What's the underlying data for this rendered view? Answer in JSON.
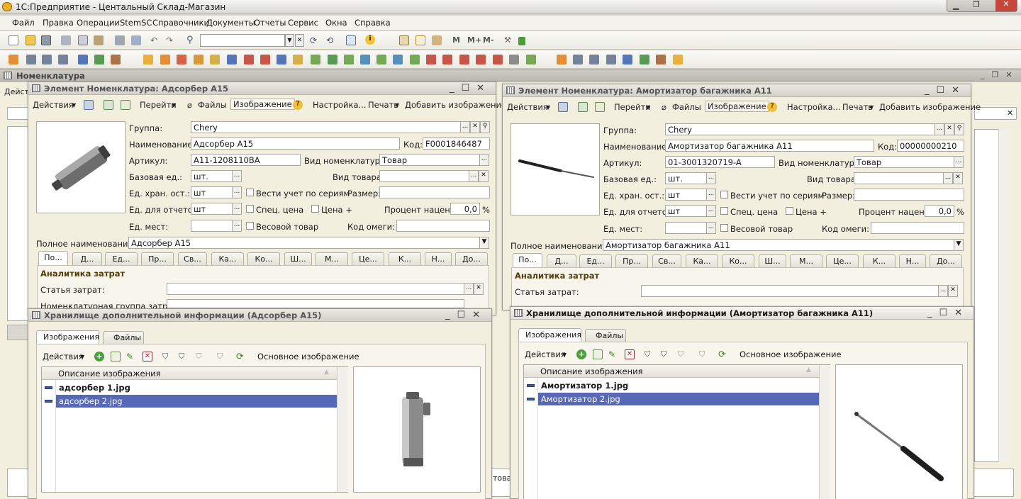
{
  "app_title": "1С:Предприятие - Центальный Склад-Магазин",
  "menu": [
    "Файл",
    "Правка",
    "Операции",
    "StemSC",
    "Справочники",
    "Документы",
    "Отчеты",
    "Сервис",
    "Окна",
    "Справка"
  ],
  "toolbar_memory": [
    "M",
    "M+",
    "M-"
  ],
  "main_window": {
    "title": "Номенклатура",
    "actions": "Дейст"
  },
  "form_labels": {
    "group": "Группа:",
    "name": "Наименование:",
    "code": "Код:",
    "article": "Артикул:",
    "nom_kind": "Вид номенклатуры:",
    "base_unit": "Базовая ед.:",
    "goods_kind": "Вид товара:",
    "storage_unit": "Ед. хран. ост.:",
    "series": "Вести учет по сериям",
    "size": "Размер:",
    "report_unit": "Ед. для отчетов:",
    "spec_price": "Спец. цена",
    "price_plus": "Цена +",
    "markup": "Процент наценки:",
    "places": "Ед. мест:",
    "weight": "Весовой товар",
    "omega": "Код омеги:",
    "full_name": "Полное наименование:",
    "analytics": "Аналитика затрат",
    "cost_item": "Статья затрат:",
    "nom_group_cost": "Номенклатурная группа затрат:",
    "percent": "%"
  },
  "form_toolbar": [
    "Действия",
    "Перейти",
    "Файлы",
    "Изображение",
    "Настройка...",
    "Печать",
    "Добавить изображение"
  ],
  "form_tabs": [
    "По...",
    "Д...",
    "Ед...",
    "Пр...",
    "Св...",
    "Ка...",
    "Ко...",
    "Ш...",
    "М...",
    "Це...",
    "К...",
    "Н...",
    "До..."
  ],
  "form1": {
    "title": "Элемент Номенклатура: Адсорбер А15",
    "group": "Chery",
    "name": "Адсорбер А15",
    "code": "F0001846487",
    "article": "A11-1208110BA",
    "nom_kind": "Товар",
    "base_unit": "шт.",
    "storage_unit": "шт",
    "report_unit": "шт",
    "markup": "0,0",
    "full_name": "Адсорбер А15"
  },
  "form2": {
    "title": "Элемент Номенклатура: Амортизатор багажника А11",
    "group": "Chery",
    "name": "Амортизатор багажника А11",
    "code": "00000000210",
    "article": "01-3001320719-A",
    "nom_kind": "Товар",
    "base_unit": "шт.",
    "storage_unit": "шт",
    "report_unit": "шт",
    "markup": "0,0",
    "full_name": "Амортизатор багажника А11"
  },
  "storage_tabs": [
    "Изображения",
    "Файлы"
  ],
  "storage_toolbar": {
    "actions": "Действия",
    "main_image": "Основное изображение"
  },
  "storage_col_header": "Описание изображения",
  "storage1": {
    "title": "Хранилище дополнительной информации (Адсорбер А15)",
    "rows": [
      "адсорбер 1.jpg",
      "адсорбер 2.jpg"
    ]
  },
  "storage2": {
    "title": "Хранилище дополнительной информации (Амортизатор багажника А11)",
    "rows": [
      "Амортизатор 1.jpg",
      "Амортизатор 2.jpg"
    ]
  },
  "bg_fragment": "това",
  "icons": [
    "app-logo-icon",
    "new-icon",
    "open-icon",
    "save-icon",
    "cut-icon",
    "copy-icon",
    "paste-icon",
    "print-icon",
    "undo-icon",
    "redo-icon",
    "search-icon",
    "info-icon",
    "calculator-icon",
    "calendar-icon",
    "help-icon",
    "add-icon",
    "edit-icon",
    "delete-icon",
    "filter-icon",
    "refresh-icon",
    "attach-icon"
  ]
}
